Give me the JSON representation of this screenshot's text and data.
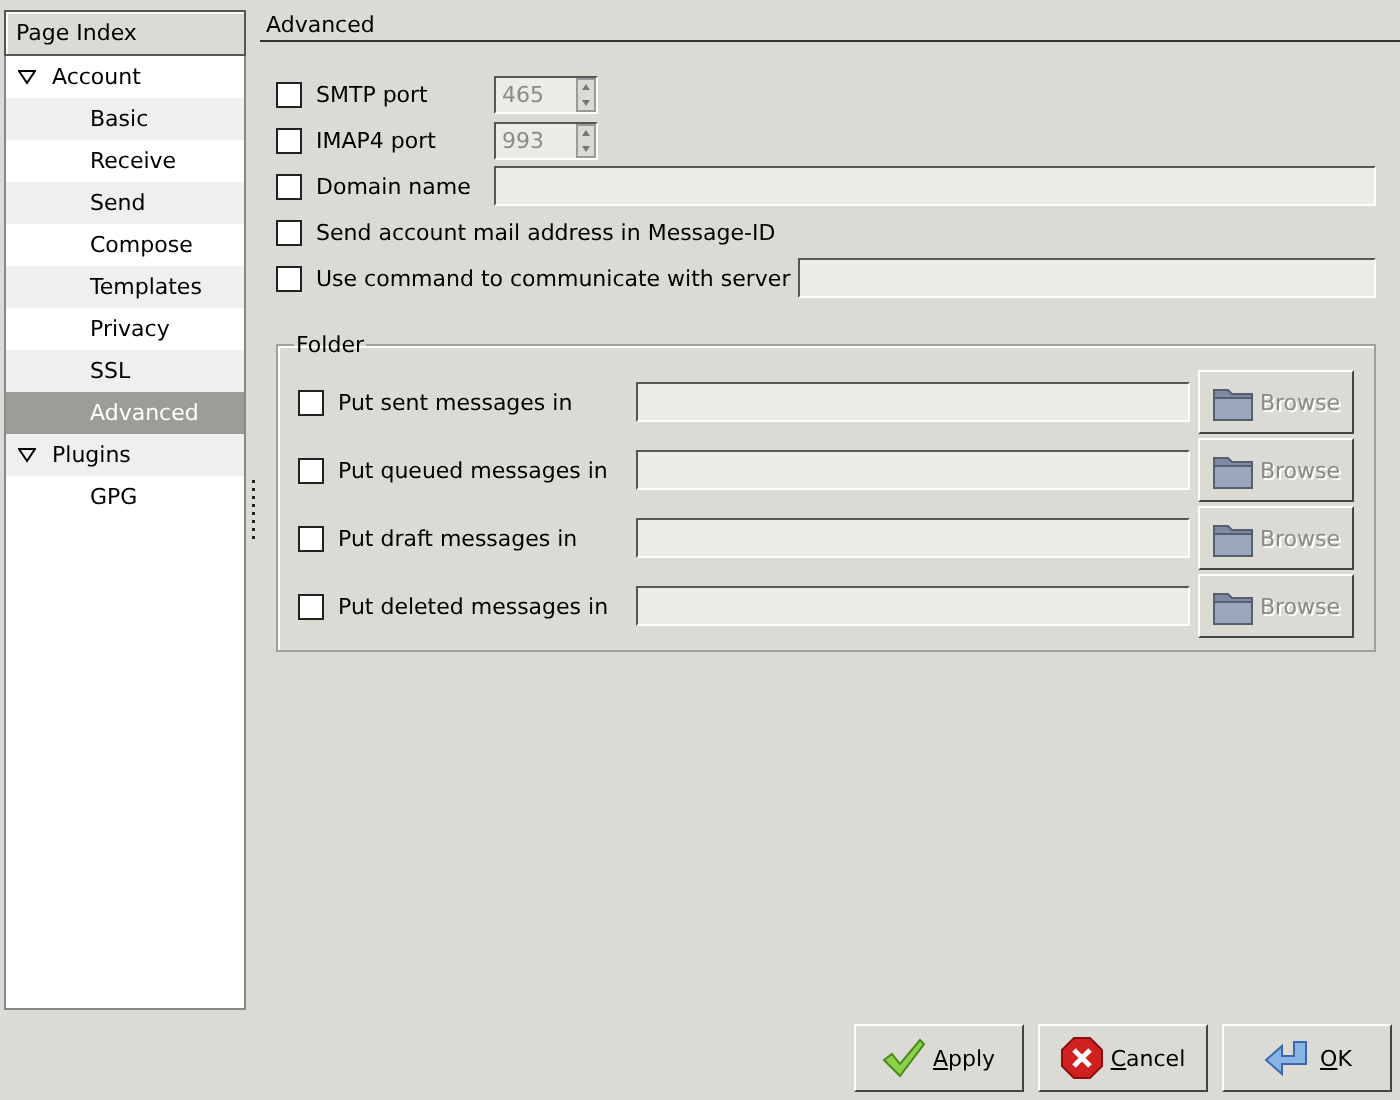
{
  "sidebar": {
    "title": "Page Index",
    "tree": [
      {
        "label": "Account",
        "expanded": true,
        "selected": false,
        "children": [
          {
            "label": "Basic",
            "selected": false
          },
          {
            "label": "Receive",
            "selected": false
          },
          {
            "label": "Send",
            "selected": false
          },
          {
            "label": "Compose",
            "selected": false
          },
          {
            "label": "Templates",
            "selected": false
          },
          {
            "label": "Privacy",
            "selected": false
          },
          {
            "label": "SSL",
            "selected": false
          },
          {
            "label": "Advanced",
            "selected": true
          }
        ]
      },
      {
        "label": "Plugins",
        "expanded": true,
        "selected": false,
        "children": [
          {
            "label": "GPG",
            "selected": false
          }
        ]
      }
    ]
  },
  "page": {
    "title": "Advanced",
    "options": [
      {
        "label": "SMTP port",
        "checked": false,
        "kind": "spin",
        "value": "465",
        "disabled": true
      },
      {
        "label": "IMAP4 port",
        "checked": false,
        "kind": "spin",
        "value": "993",
        "disabled": true
      },
      {
        "label": "Domain name",
        "checked": false,
        "kind": "text",
        "disabled": false
      },
      {
        "label": "Send account mail address in Message-ID",
        "checked": false,
        "kind": "plain"
      },
      {
        "label": "Use command to communicate with server",
        "checked": false,
        "kind": "text",
        "disabled": false
      }
    ],
    "folder": {
      "title": "Folder",
      "rows": [
        {
          "label": "Put sent messages in",
          "checked": false,
          "button": "Browse",
          "disabled": true
        },
        {
          "label": "Put queued messages in",
          "checked": false,
          "button": "Browse",
          "disabled": true
        },
        {
          "label": "Put draft messages in",
          "checked": false,
          "button": "Browse",
          "disabled": true
        },
        {
          "label": "Put deleted messages in",
          "checked": false,
          "button": "Browse",
          "disabled": true
        }
      ]
    }
  },
  "buttons": [
    {
      "label": "Apply",
      "kind": "apply"
    },
    {
      "label": "Cancel",
      "kind": "cancel"
    },
    {
      "label": "OK",
      "kind": "ok"
    }
  ]
}
